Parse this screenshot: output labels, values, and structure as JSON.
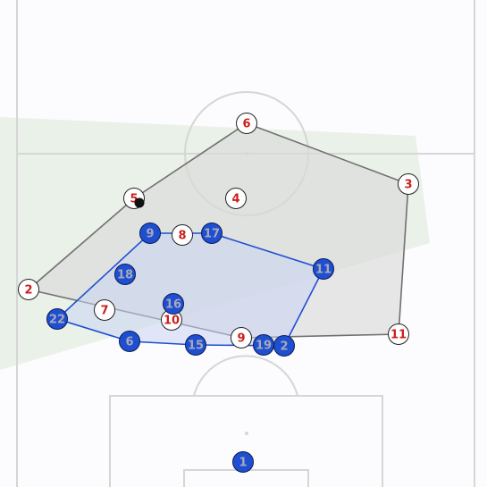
{
  "colors": {
    "background": "#fcfbfd",
    "pitch_lines": "#d6d6d6",
    "pitch_lines_light": "#e6e6e6",
    "opposition_hull_fill": "#d9d9d9",
    "opposition_hull_stroke": "#707070",
    "team_hull_fill": "#c9d4f2",
    "team_hull_stroke": "#1f4fd1",
    "team_marker": "#1f4fd1",
    "team_text": "#a9a9b8",
    "opposition_marker": "#ffffff",
    "opposition_text": "#cc1f1f",
    "shadow_band": "#e4ede0",
    "ball": "#111111"
  },
  "team_blue": {
    "players": [
      {
        "number": "1"
      },
      {
        "number": "2"
      },
      {
        "number": "6"
      },
      {
        "number": "9"
      },
      {
        "number": "11"
      },
      {
        "number": "15"
      },
      {
        "number": "16"
      },
      {
        "number": "17"
      },
      {
        "number": "18"
      },
      {
        "number": "19"
      },
      {
        "number": "22"
      }
    ]
  },
  "team_white": {
    "players": [
      {
        "number": "2"
      },
      {
        "number": "3"
      },
      {
        "number": "4"
      },
      {
        "number": "5"
      },
      {
        "number": "6"
      },
      {
        "number": "7"
      },
      {
        "number": "8"
      },
      {
        "number": "9"
      },
      {
        "number": "10"
      },
      {
        "number": "11"
      }
    ]
  }
}
